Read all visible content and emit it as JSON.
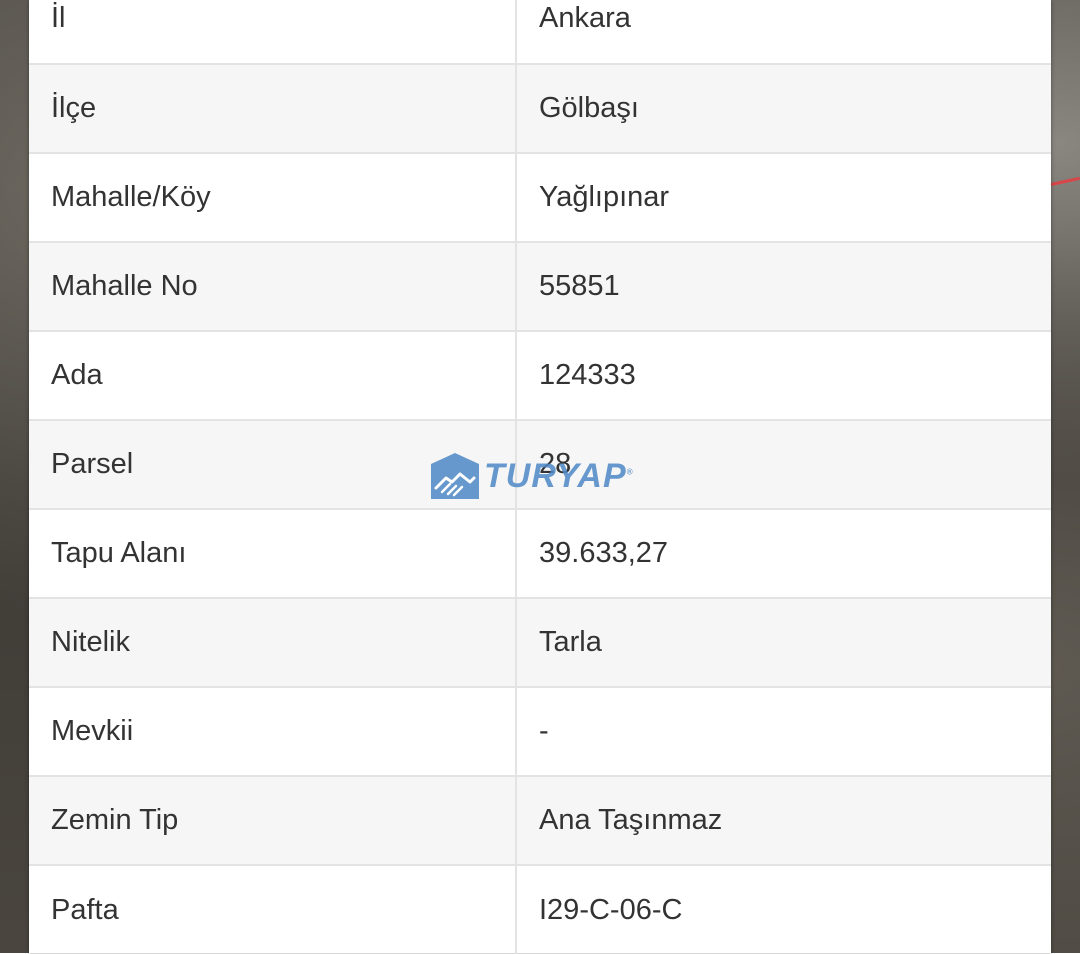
{
  "rows": [
    {
      "label": "İl",
      "value": "Ankara"
    },
    {
      "label": "İlçe",
      "value": "Gölbaşı"
    },
    {
      "label": "Mahalle/Köy",
      "value": "Yağlıpınar"
    },
    {
      "label": "Mahalle No",
      "value": "55851"
    },
    {
      "label": "Ada",
      "value": "124333"
    },
    {
      "label": "Parsel",
      "value": "28"
    },
    {
      "label": "Tapu Alanı",
      "value": "39.633,27"
    },
    {
      "label": "Nitelik",
      "value": "Tarla"
    },
    {
      "label": "Mevkii",
      "value": "-"
    },
    {
      "label": "Zemin Tip",
      "value": "Ana Taşınmaz"
    },
    {
      "label": "Pafta",
      "value": "I29-C-06-C"
    }
  ],
  "watermark": {
    "brand": "TURYAP",
    "registered": "®",
    "color": "#4e88c6"
  },
  "colors": {
    "row_alt": "#f6f6f6",
    "border": "#e3e3e3",
    "text": "#333333"
  }
}
